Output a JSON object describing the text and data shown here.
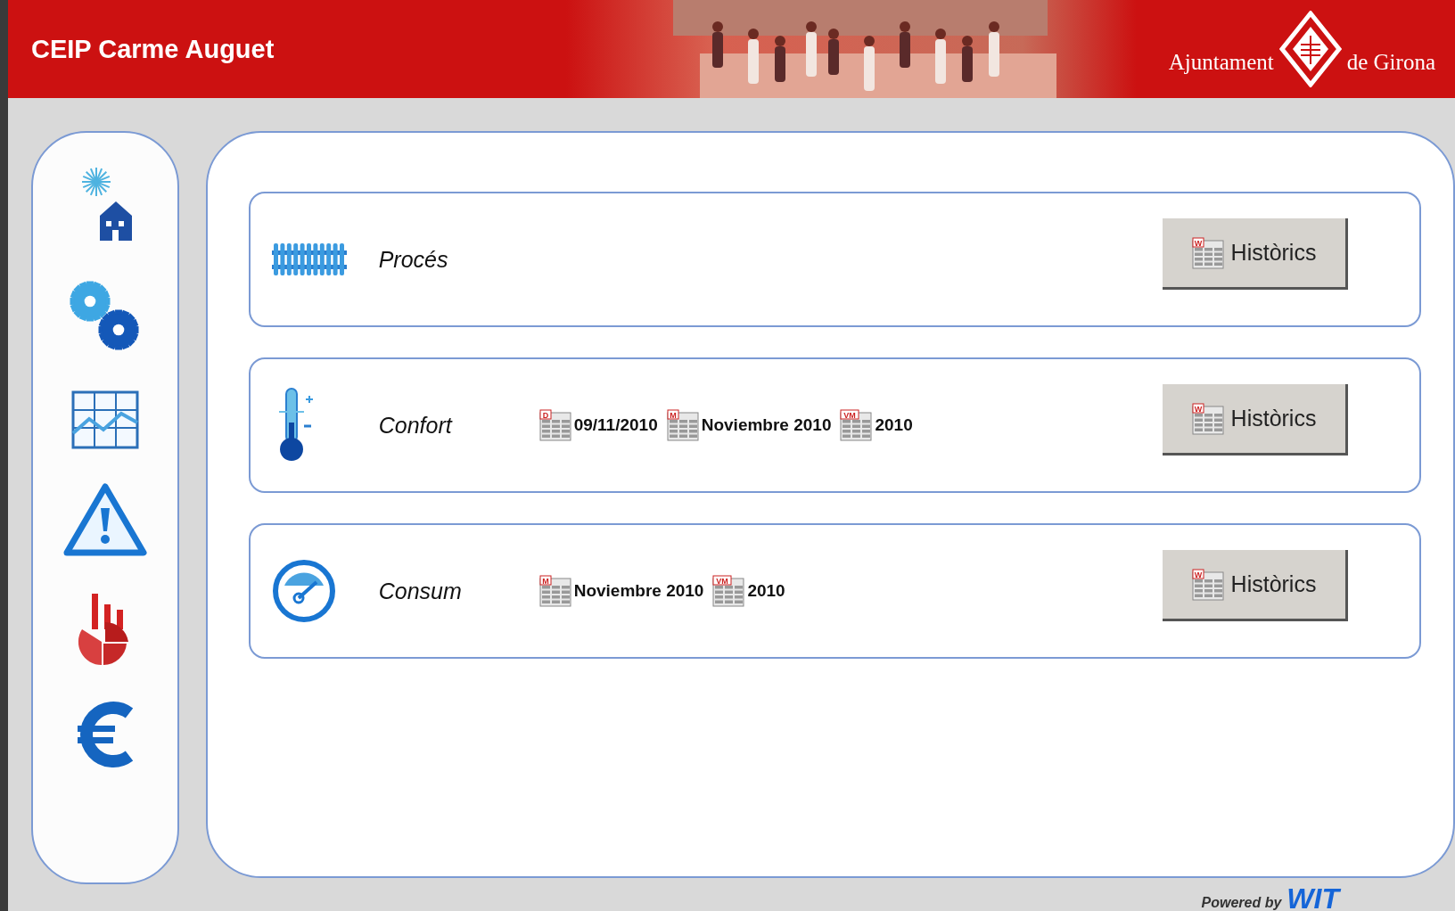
{
  "header": {
    "title": "CEIP Carme Auguet",
    "logo_left": "Ajuntament",
    "logo_right": "de Girona"
  },
  "sections": [
    {
      "kind": "radiator",
      "title": "Procés",
      "button": {
        "badge": "W",
        "label": "Històrics"
      }
    },
    {
      "kind": "thermometer",
      "title": "Confort",
      "reports": [
        {
          "badge": "D",
          "label": "09/11/2010"
        },
        {
          "badge": "M",
          "label": "Noviembre 2010"
        },
        {
          "badge": "VM",
          "label": "2010"
        }
      ],
      "button": {
        "badge": "W",
        "label": "Històrics"
      }
    },
    {
      "kind": "gauge",
      "title": "Consum",
      "reports": [
        {
          "badge": "M",
          "label": "Noviembre 2010"
        },
        {
          "badge": "VM",
          "label": "2010"
        }
      ],
      "button": {
        "badge": "W",
        "label": "Històrics"
      }
    }
  ],
  "footer": {
    "powered": "Powered by",
    "brand": "WIT"
  }
}
